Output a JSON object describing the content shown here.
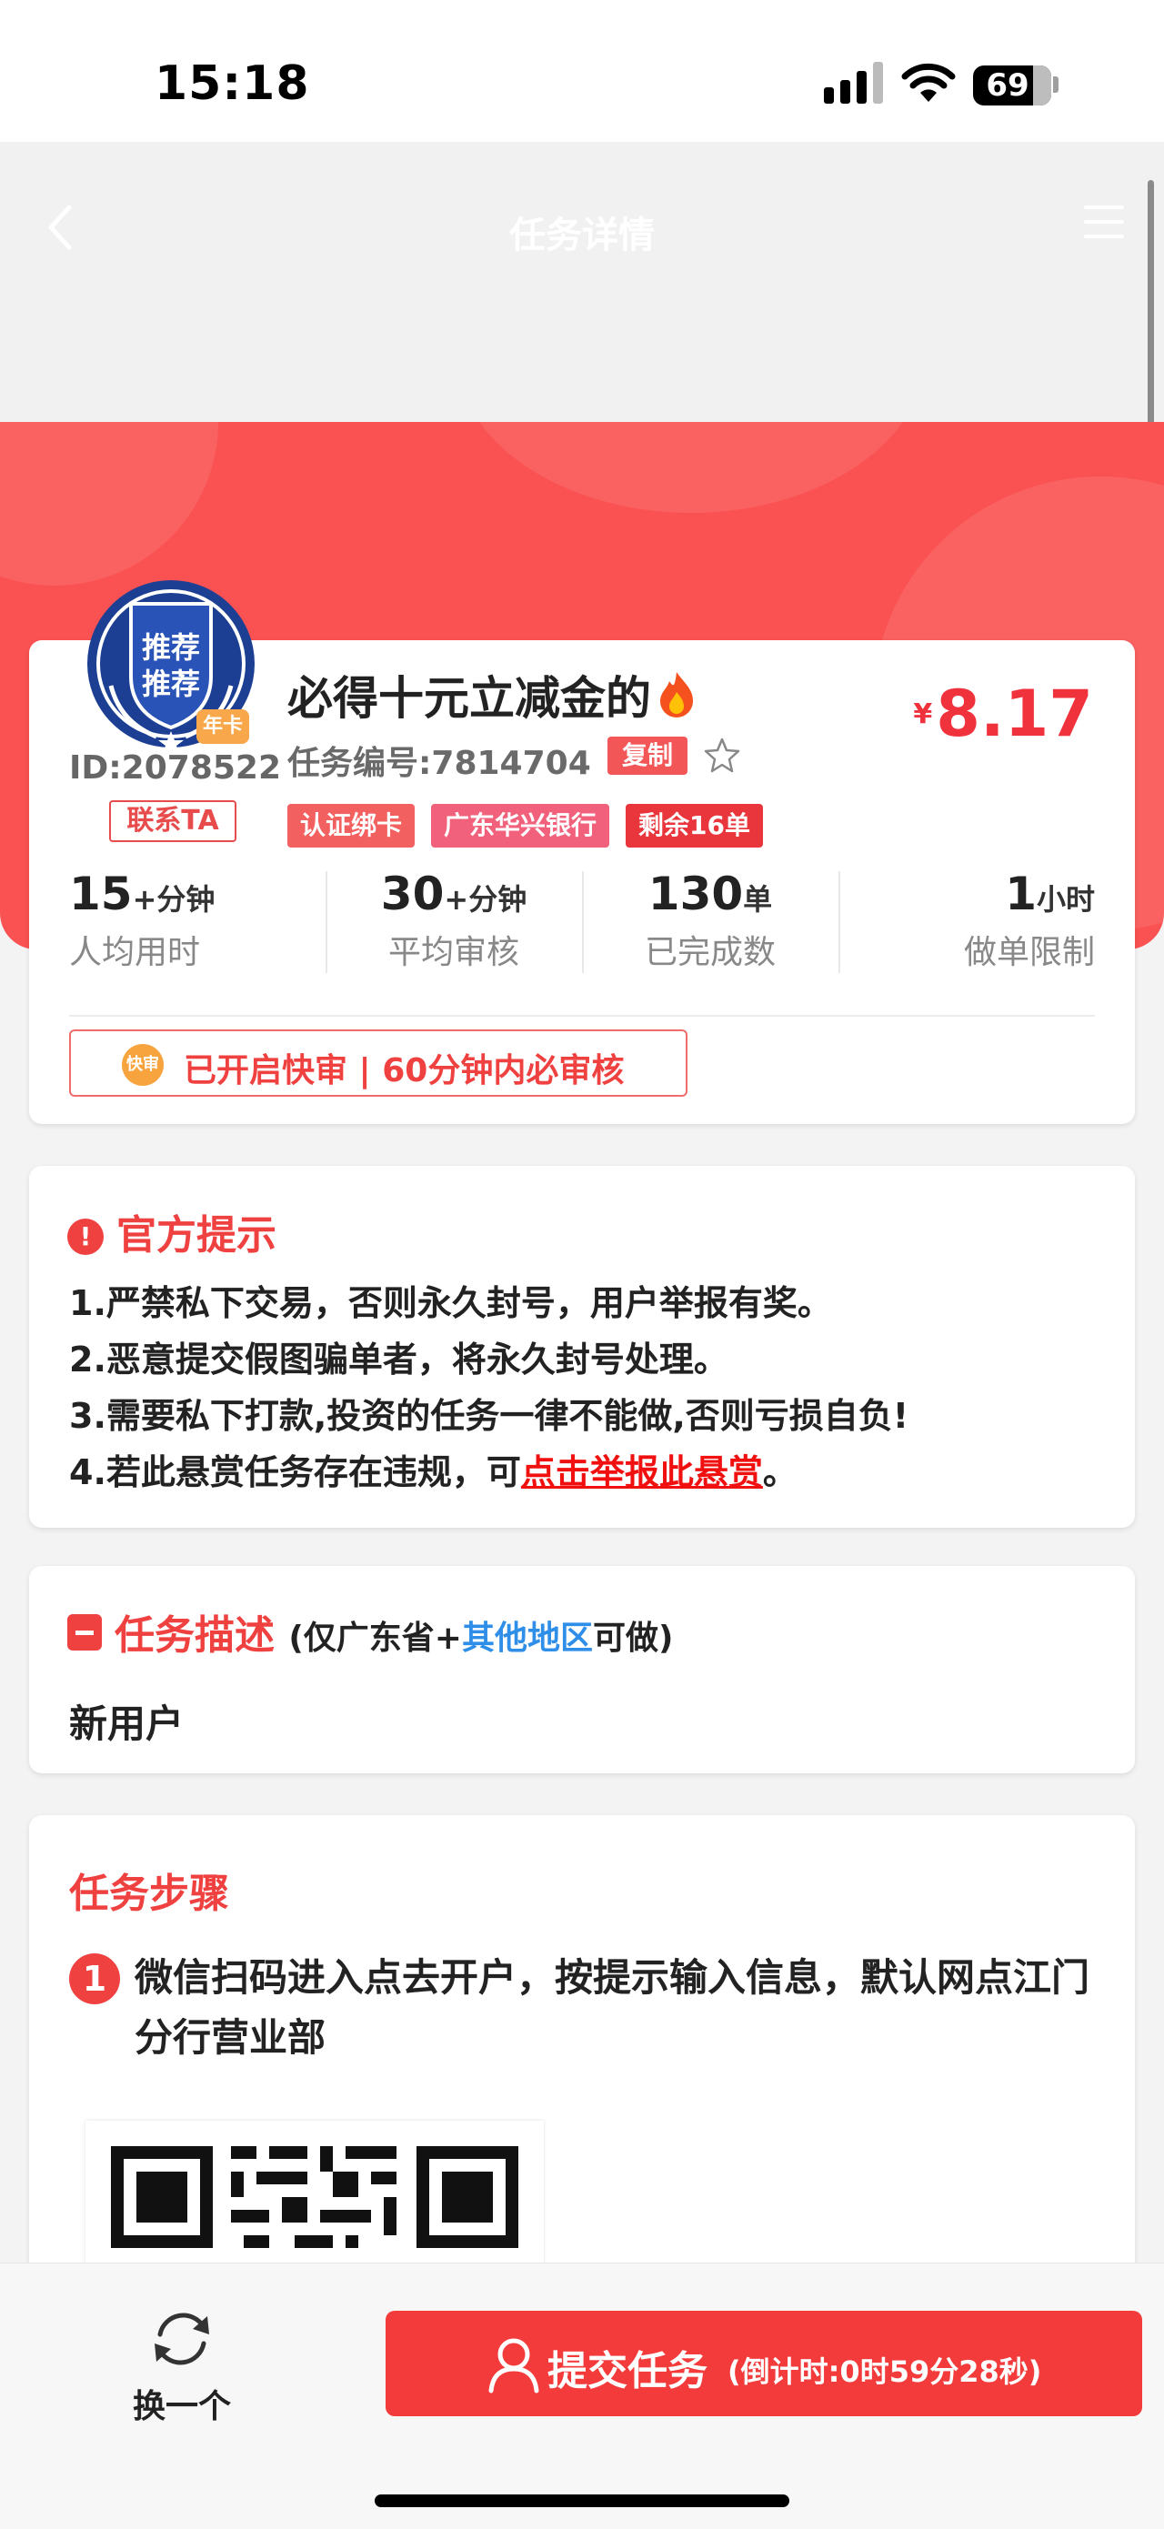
{
  "status_bar": {
    "time": "15:18",
    "battery": "69"
  },
  "nav": {
    "title": "任务详情"
  },
  "task": {
    "badge_text": "推荐推荐",
    "badge_ribbon": "年卡",
    "user_id": "ID:2078522",
    "contact_label": "联系TA",
    "title": "必得十元立减金的",
    "task_no": "任务编号:7814704",
    "copy_label": "复制",
    "price_currency": "¥",
    "price": "8.17",
    "tags": [
      {
        "label": "认证绑卡",
        "color": "#f2615f"
      },
      {
        "label": "广东华兴银行",
        "color": "#f2617c"
      },
      {
        "label": "剩余16单",
        "color": "#e8363c"
      }
    ],
    "stats": [
      {
        "value": "15",
        "unit": "+分钟",
        "label": "人均用时"
      },
      {
        "value": "30",
        "unit": "+分钟",
        "label": "平均审核"
      },
      {
        "value": "130",
        "unit": "单",
        "label": "已完成数"
      },
      {
        "value": "1",
        "unit": "小时",
        "label": "做单限制"
      }
    ],
    "fast_review_icon": "快审",
    "fast_review_text": "已开启快审 | 60分钟内必审核"
  },
  "notice": {
    "title": "官方提示",
    "items": [
      "1.严禁私下交易，否则永久封号，用户举报有奖。",
      "2.恶意提交假图骗单者，将永久封号处理。",
      "3.需要私下打款,投资的任务一律不能做,否则亏损自负!",
      "4.若此悬赏任务存在违规，可"
    ],
    "report_link": "点击举报此悬赏",
    "report_suffix": "。"
  },
  "description": {
    "title": "任务描述",
    "scope_prefix": "(仅广东省+",
    "scope_region": "其他地区",
    "scope_suffix": "可做)",
    "body": "新用户"
  },
  "steps": {
    "title": "任务步骤",
    "items": [
      {
        "num": "1",
        "text": "微信扫码进入点去开户，按提示输入信息，默认网点江门分行营业部"
      }
    ]
  },
  "bottom": {
    "switch_label": "换一个",
    "submit_label": "提交任务",
    "countdown": "(倒计时:0时59分28秒)"
  },
  "colors": {
    "accent": "#f04141",
    "banner": "#fa5252",
    "link": "#2f8ee8"
  }
}
